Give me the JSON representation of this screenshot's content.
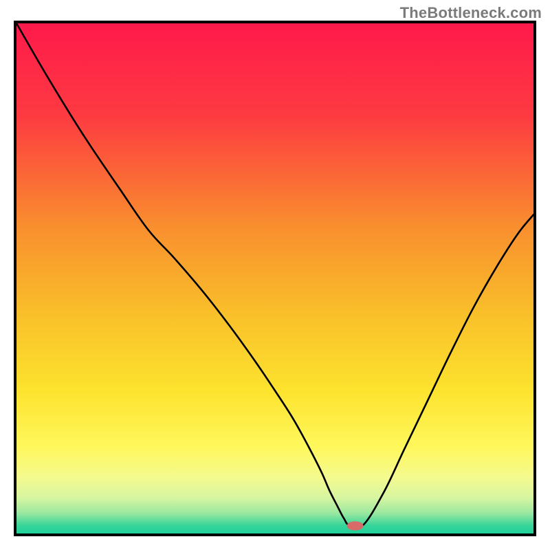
{
  "attribution": "TheBottleneck.com",
  "chart_data": {
    "type": "line",
    "title": "",
    "xlabel": "",
    "ylabel": "",
    "xlim": [
      0,
      100
    ],
    "ylim": [
      0,
      100
    ],
    "grid": false,
    "legend": false,
    "background_gradient_stops": [
      {
        "offset": 0.0,
        "color": "#ff1a4b"
      },
      {
        "offset": 0.18,
        "color": "#fd3a41"
      },
      {
        "offset": 0.4,
        "color": "#f98f2e"
      },
      {
        "offset": 0.58,
        "color": "#f9c22a"
      },
      {
        "offset": 0.72,
        "color": "#fde32e"
      },
      {
        "offset": 0.83,
        "color": "#fff85c"
      },
      {
        "offset": 0.89,
        "color": "#f4fa8f"
      },
      {
        "offset": 0.93,
        "color": "#d7f5a0"
      },
      {
        "offset": 0.96,
        "color": "#9ae8a0"
      },
      {
        "offset": 0.985,
        "color": "#35d49a"
      },
      {
        "offset": 1.0,
        "color": "#1fd19a"
      }
    ],
    "series": [
      {
        "name": "bottleneck-curve",
        "x": [
          0.0,
          6.0,
          13.0,
          20.0,
          25.5,
          30.5,
          36.0,
          41.0,
          46.0,
          50.0,
          53.5,
          56.5,
          59.0,
          60.5,
          62.0,
          63.3,
          64.4,
          67.0,
          71.0,
          75.0,
          79.5,
          84.0,
          88.5,
          93.0,
          97.0,
          100.0
        ],
        "y": [
          100.0,
          89.5,
          78.0,
          67.5,
          59.5,
          54.0,
          47.5,
          41.0,
          34.0,
          28.0,
          22.5,
          17.0,
          12.0,
          8.5,
          5.5,
          3.0,
          1.6,
          1.6,
          8.0,
          16.5,
          26.0,
          35.5,
          44.5,
          52.5,
          58.8,
          62.5
        ]
      }
    ],
    "marker": {
      "name": "optimum-marker",
      "x": 65.5,
      "y": 1.5,
      "rx": 1.6,
      "ry": 0.9,
      "fill": "#d96a6a"
    }
  }
}
